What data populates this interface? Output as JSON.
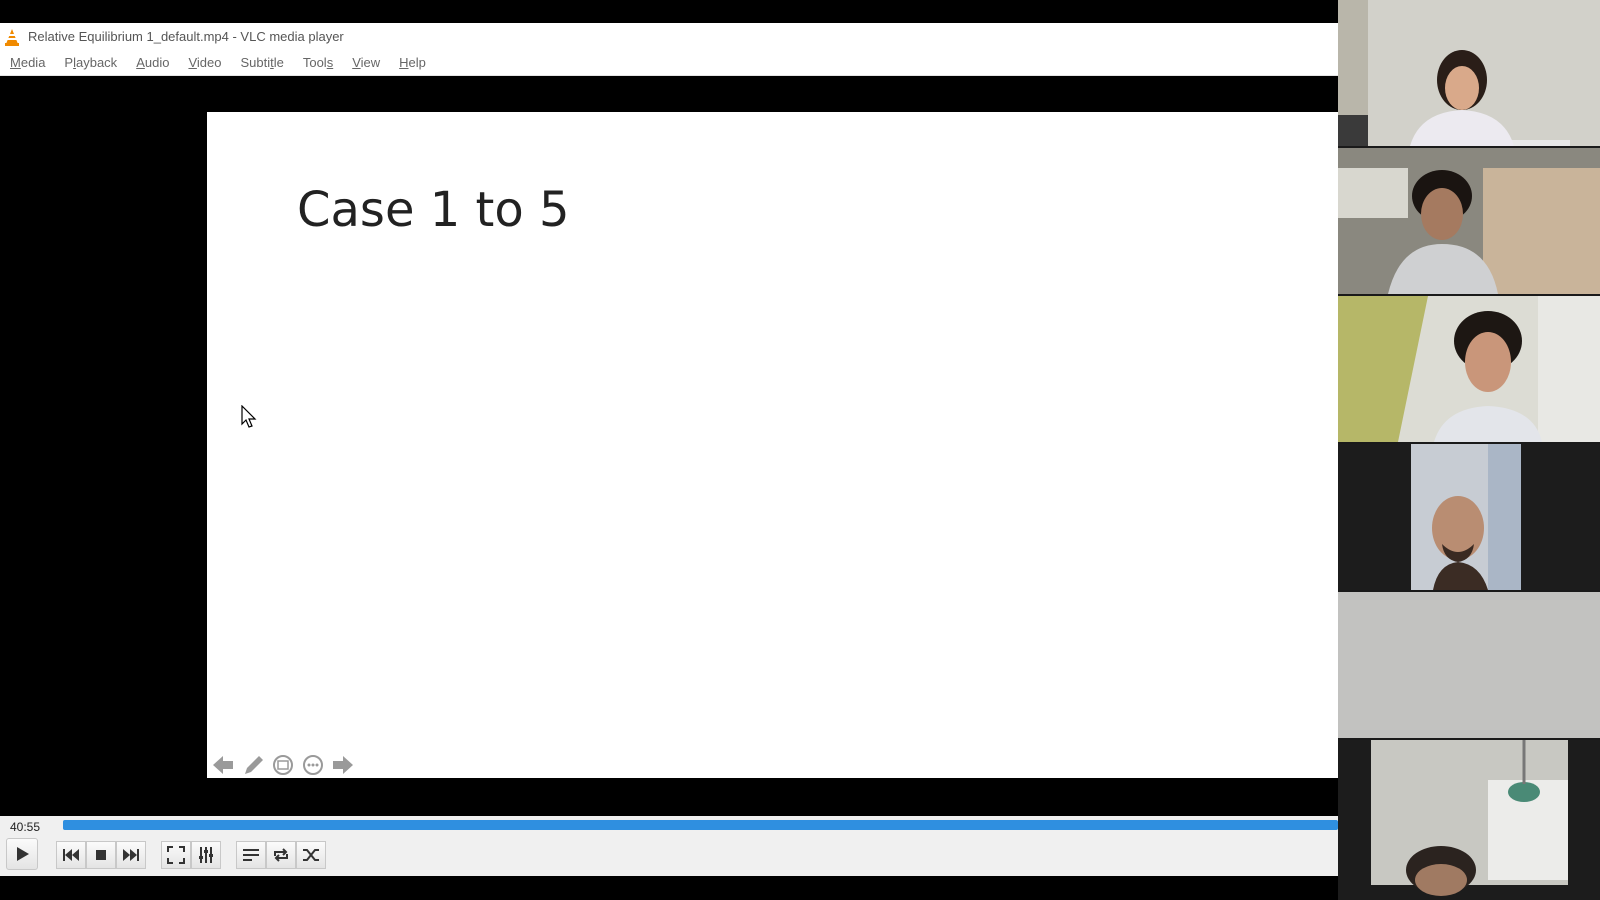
{
  "window": {
    "title": "Relative Equilibrium 1_default.mp4 - VLC media player"
  },
  "menu": [
    {
      "label": "Media",
      "underline": "M",
      "rest": "edia"
    },
    {
      "label": "Playback",
      "underline": "",
      "pre": "P",
      "mid": "l",
      "rest": "ayback"
    },
    {
      "label": "Audio",
      "underline": "A",
      "rest": "udio"
    },
    {
      "label": "Video",
      "underline": "V",
      "rest": "ideo"
    },
    {
      "label": "Subtitle",
      "underline": "",
      "rest": "Subtitle"
    },
    {
      "label": "Tools",
      "underline": "",
      "rest": "Tools"
    },
    {
      "label": "View",
      "underline": "",
      "rest": "View"
    },
    {
      "label": "Help",
      "underline": "H",
      "rest": "elp"
    }
  ],
  "slide": {
    "title": "Case 1 to 5"
  },
  "player": {
    "elapsed": "40:55",
    "progress_fraction": 1.0
  },
  "participants": [
    {
      "name": "participant-1",
      "bg": "#cfcfc8"
    },
    {
      "name": "participant-2",
      "bg": "#8c8a83"
    },
    {
      "name": "participant-3",
      "bg": "#d9dcd6"
    },
    {
      "name": "participant-4",
      "bg": "#1c1c1c"
    },
    {
      "name": "participant-5",
      "bg": "#bdbdbb"
    },
    {
      "name": "participant-6",
      "bg": "#1c1c1c"
    }
  ],
  "colors": {
    "accent": "#2f8fe0",
    "vlc_orange": "#f08a00"
  }
}
